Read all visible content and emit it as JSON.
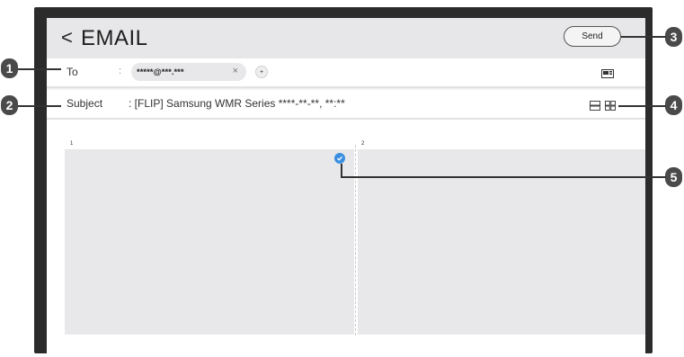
{
  "header": {
    "back_glyph": "<",
    "title": "EMAIL",
    "send_label": "Send"
  },
  "to_row": {
    "label": "To",
    "colon": ":",
    "recipient": "*****@***.***",
    "remove_glyph": "×",
    "add_glyph": "+"
  },
  "subject_row": {
    "label": "Subject",
    "value": ": [FLIP] Samsung WMR Series ****-**-**, **:**"
  },
  "pages": {
    "page1_number": "1",
    "page2_number": "2"
  },
  "callouts": [
    "1",
    "2",
    "3",
    "4",
    "5"
  ],
  "colors": {
    "frame": "#2b2b2b",
    "check_accent": "#3a8fe0",
    "badge": "#4a4a4a"
  },
  "icons": {
    "keyboard": "keyboard-icon",
    "layout_single": "layout-single-icon",
    "layout_grid": "layout-grid-icon",
    "check": "check-circle-icon"
  }
}
